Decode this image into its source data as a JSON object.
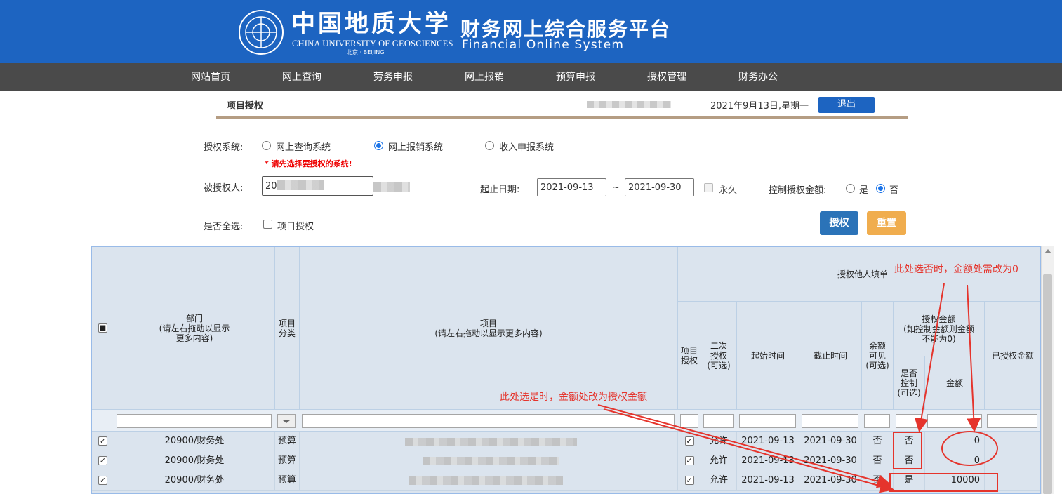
{
  "header": {
    "school_cn": "中国地质大学",
    "school_en": "CHINA UNIVERSITY OF GEOSCIENCES",
    "school_city": "北京 · BEIJING",
    "platform_cn": "财务网上综合服务平台",
    "platform_en": "Financial Online System",
    "brand_color": "#1d64c1"
  },
  "nav": [
    "网站首页",
    "网上查询",
    "劳务申报",
    "网上报销",
    "预算申报",
    "授权管理",
    "财务办公"
  ],
  "titlebar": {
    "title": "项目授权",
    "date": "2021年9月13日,星期一",
    "logout": "退出"
  },
  "form": {
    "system_label": "授权系统:",
    "systems": [
      "网上查询系统",
      "网上报销系统",
      "收入申报系统"
    ],
    "selected_system": "网上报销系统",
    "warning": "* 请先选择要授权的系统!",
    "grantee_label": "被授权人:",
    "grantee_value": "20",
    "date_label": "起止日期:",
    "start_date": "2021-09-13",
    "date_sep": "~",
    "end_date": "2021-09-30",
    "forever_label": "永久",
    "control_label": "控制授权金额:",
    "control_yes": "是",
    "control_no": "否",
    "select_all_label": "是否全选:",
    "select_all_option": "项目授权",
    "btn_authorize": "授权",
    "btn_reset": "重置"
  },
  "grid": {
    "group_header": "授权他人填单",
    "headers": {
      "dept": "部门\n(请左右拖动以显示\n更多内容)",
      "category": "项目\n分类",
      "project": "项目\n(请左右拖动以显示更多内容)",
      "proj_auth": "项目\n授权",
      "second_auth": "二次\n授权\n(可选)",
      "start": "起始时间",
      "end": "截止时间",
      "balance_visible": "余额\n可见\n(可选)",
      "amount_group": "授权金额\n(如控制金额则金额\n不能为0)",
      "is_control": "是否\n控制\n(可选)",
      "amount": "金额",
      "granted_amount": "已授权金额"
    },
    "rows": [
      {
        "checked": "✓",
        "dept": "20900/财务处",
        "category": "预算",
        "proj_auth": "✓",
        "second": "允许",
        "start": "2021-09-13",
        "end": "2021-09-30",
        "balance": "否",
        "control": "否",
        "amount": "0"
      },
      {
        "checked": "✓",
        "dept": "20900/财务处",
        "category": "预算",
        "proj_auth": "✓",
        "second": "允许",
        "start": "2021-09-13",
        "end": "2021-09-30",
        "balance": "否",
        "control": "否",
        "amount": "0"
      },
      {
        "checked": "✓",
        "dept": "20900/财务处",
        "category": "预算",
        "proj_auth": "✓",
        "second": "允许",
        "start": "2021-09-13",
        "end": "2021-09-30",
        "balance": "否",
        "control": "是",
        "amount": "10000"
      }
    ]
  },
  "annotations": {
    "note_no": "此处选否时，金额处需改为0",
    "note_yes": "此处选是时，金额处改为授权金额",
    "color": "#e5342c"
  }
}
